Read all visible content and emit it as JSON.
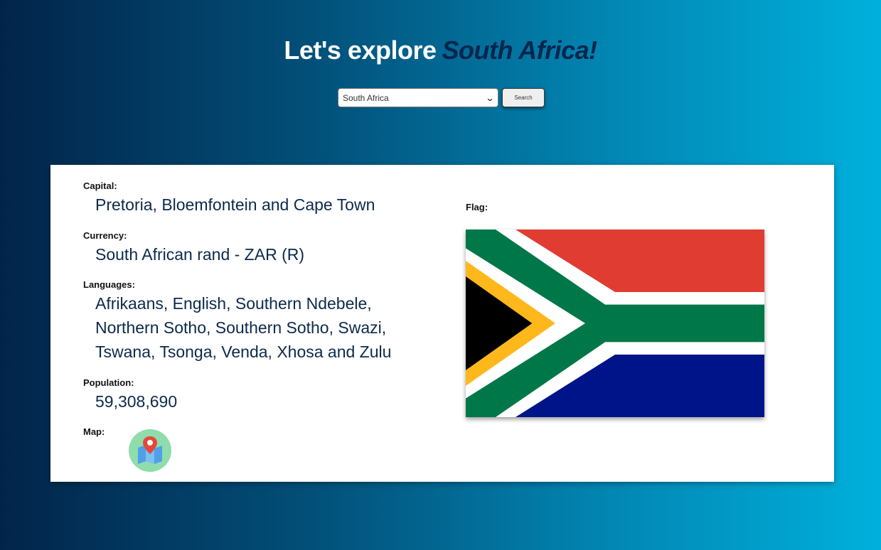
{
  "header": {
    "title_prefix": "Let's explore",
    "country_name": "South Africa!"
  },
  "search": {
    "selected_country": "South Africa",
    "button_label": "Search"
  },
  "details": {
    "capital_label": "Capital:",
    "capital_value": "Pretoria, Bloemfontein and Cape Town",
    "currency_label": "Currency:",
    "currency_value": "South African rand - ZAR (R)",
    "languages_label": "Languages:",
    "languages_line1": "Afrikaans, English, Southern Ndebele,",
    "languages_line2": "Northern Sotho, Southern Sotho, Swazi,",
    "languages_line3": "Tswana, Tsonga, Venda, Xhosa and Zulu",
    "population_label": "Population:",
    "population_value": "59,308,690",
    "map_label": "Map:",
    "map_icon": "map-pin-icon",
    "flag_label": "Flag:"
  },
  "colors": {
    "background_start": "#02244a",
    "background_end": "#00b0dc",
    "title_accent": "#03264d",
    "value_text": "#0c2a4a",
    "map_icon_bg": "#8fddac",
    "flag_red": "#e03c31",
    "flag_blue": "#001489",
    "flag_green": "#007749",
    "flag_gold": "#ffb81c",
    "flag_black": "#000000",
    "flag_white": "#ffffff"
  }
}
